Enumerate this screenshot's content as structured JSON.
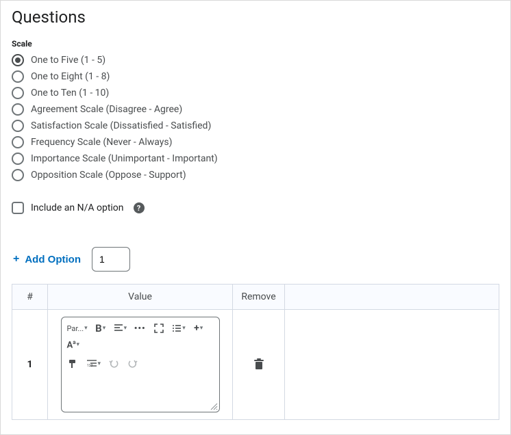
{
  "title": "Questions",
  "scale": {
    "label": "Scale",
    "selected_index": 0,
    "options": [
      "One to Five (1 - 5)",
      "One to Eight (1 - 8)",
      "One to Ten (1 - 10)",
      "Agreement Scale (Disagree - Agree)",
      "Satisfaction Scale (Dissatisfied - Satisfied)",
      "Frequency Scale (Never - Always)",
      "Importance Scale (Unimportant - Important)",
      "Opposition Scale (Oppose - Support)"
    ]
  },
  "include_na": {
    "label": "Include an N/A option",
    "checked": false
  },
  "add_option": {
    "label": "Add Option",
    "count": "1"
  },
  "table": {
    "headers": {
      "num": "#",
      "value": "Value",
      "remove": "Remove"
    },
    "rows": [
      {
        "num": "1",
        "value": ""
      }
    ]
  },
  "editor_toolbar": {
    "paragraph": "Par..."
  }
}
